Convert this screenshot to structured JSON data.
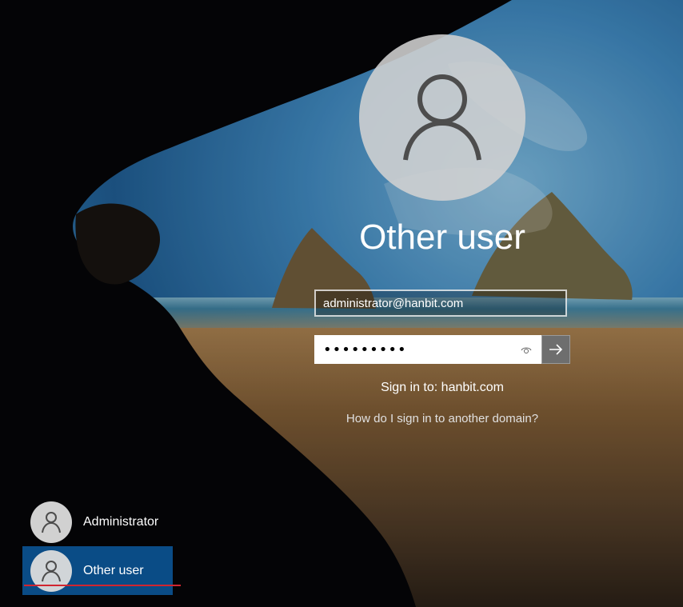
{
  "selected_user": {
    "display_name": "Other user",
    "avatar_icon": "user-silhouette-icon"
  },
  "signin_form": {
    "username_value": "administrator@hanbit.com",
    "password_mask": "•••••••••",
    "reveal_icon": "eye-icon",
    "submit_icon": "arrow-right-icon",
    "signin_domain_text": "Sign in to: hanbit.com",
    "domain_help_link": "How do I sign in to another domain?"
  },
  "user_list": [
    {
      "label": "Administrator",
      "avatar_icon": "user-silhouette-icon",
      "selected": false
    },
    {
      "label": "Other user",
      "avatar_icon": "user-silhouette-icon",
      "selected": true
    }
  ],
  "colors": {
    "selected_user_bg": "#0a4c86",
    "annotation_underline": "#d1252f"
  }
}
